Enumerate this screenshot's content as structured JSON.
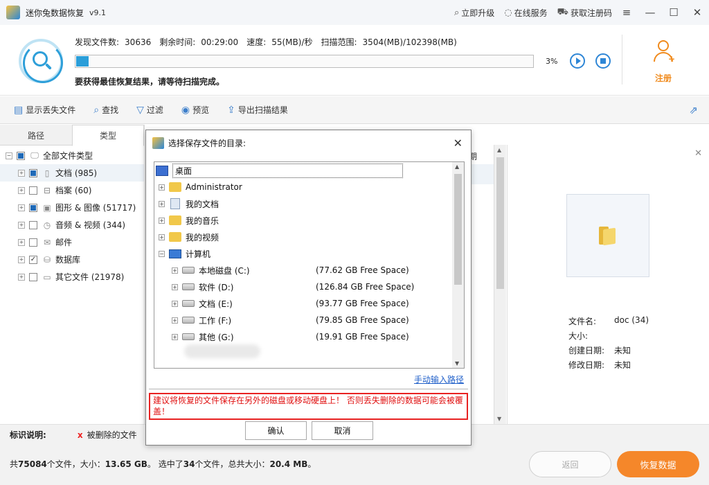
{
  "app": {
    "title": "迷你兔数据恢复",
    "version": "v9.1"
  },
  "titlebar": {
    "links": [
      {
        "icon": "search-icon",
        "label": "立即升级"
      },
      {
        "icon": "headset-icon",
        "label": "在线服务"
      },
      {
        "icon": "cart-icon",
        "label": "获取注册码"
      }
    ]
  },
  "scan": {
    "found_label": "发现文件数:",
    "found_value": "30636",
    "remaining_label": "剩余时间:",
    "remaining_value": "00:29:00",
    "speed_label": "速度:",
    "speed_value": "55(MB)/秒",
    "range_label": "扫描范围:",
    "range_value": "3504(MB)/102398(MB)",
    "progress_percent": 3,
    "percent_text": "3%",
    "hint": "要获得最佳恢复结果，请等待扫描完成。"
  },
  "register": {
    "label": "注册"
  },
  "toolbar": {
    "items": [
      {
        "icon": "show-lost-icon",
        "label": "显示丢失文件"
      },
      {
        "icon": "search-icon",
        "label": "查找"
      },
      {
        "icon": "filter-icon",
        "label": "过滤"
      },
      {
        "icon": "eye-icon",
        "label": "预览"
      },
      {
        "icon": "export-icon",
        "label": "导出扫描结果"
      }
    ]
  },
  "left": {
    "tabs": [
      "路径",
      "类型"
    ],
    "root": "全部文件类型",
    "items": [
      {
        "label": "文档 (985)",
        "check": "part"
      },
      {
        "label": "档案 (60)",
        "check": "none"
      },
      {
        "label": "图形 & 图像 (51717)",
        "check": "part"
      },
      {
        "label": "音频 & 视频 (344)",
        "check": "none"
      },
      {
        "label": "邮件",
        "check": "none"
      },
      {
        "label": "数据库",
        "check": "checked"
      },
      {
        "label": "其它文件 (21978)",
        "check": "none"
      }
    ]
  },
  "middle": {
    "col_fragment": "期"
  },
  "details": {
    "rows": [
      {
        "k": "文件名:",
        "v": "doc (34)"
      },
      {
        "k": "大小:",
        "v": ""
      },
      {
        "k": "创建日期:",
        "v": "未知"
      },
      {
        "k": "修改日期:",
        "v": "未知"
      }
    ]
  },
  "legend": {
    "title": "标识说明:",
    "mark": "x",
    "deleted": "被删除的文件",
    "q": "?"
  },
  "status": {
    "p1": "共",
    "total_files": "75084",
    "p2": "个文件，大小：",
    "total_size": "13.65 GB",
    "p3": "。 选中了",
    "sel_count": "34",
    "p4": "个文件，总共大小：",
    "sel_size": "20.4 MB",
    "p5": "。"
  },
  "buttons": {
    "back": "返回",
    "recover": "恢复数据"
  },
  "dialog": {
    "title": "选择保存文件的目录:",
    "tree": [
      {
        "label": "桌面",
        "icon": "desktop-icon",
        "indent": 0,
        "exp": "",
        "free": ""
      },
      {
        "label": "Administrator",
        "icon": "user-folder-icon",
        "indent": 1,
        "exp": "+",
        "free": ""
      },
      {
        "label": "我的文档",
        "icon": "documents-icon",
        "indent": 1,
        "exp": "+",
        "free": ""
      },
      {
        "label": "我的音乐",
        "icon": "music-folder-icon",
        "indent": 1,
        "exp": "+",
        "free": ""
      },
      {
        "label": "我的视频",
        "icon": "video-folder-icon",
        "indent": 1,
        "exp": "+",
        "free": ""
      },
      {
        "label": "计算机",
        "icon": "computer-icon",
        "indent": 1,
        "exp": "−",
        "free": ""
      },
      {
        "label": "本地磁盘 (C:)",
        "icon": "system-drive-icon",
        "indent": 2,
        "exp": "+",
        "free": "(77.62 GB Free Space)"
      },
      {
        "label": "软件 (D:)",
        "icon": "drive-icon",
        "indent": 2,
        "exp": "+",
        "free": "(126.84 GB Free Space)"
      },
      {
        "label": "文档 (E:)",
        "icon": "drive-icon",
        "indent": 2,
        "exp": "+",
        "free": "(93.77 GB Free Space)"
      },
      {
        "label": "工作 (F:)",
        "icon": "drive-icon",
        "indent": 2,
        "exp": "+",
        "free": "(79.85 GB Free Space)"
      },
      {
        "label": "其他 (G:)",
        "icon": "drive-icon",
        "indent": 2,
        "exp": "+",
        "free": "(19.91 GB Free Space)"
      }
    ],
    "manual_link": "手动输入路径",
    "warning": "建议将恢复的文件保存在另外的磁盘或移动硬盘上！ 否则丢失删除的数据可能会被覆盖！",
    "ok": "确认",
    "cancel": "取消"
  }
}
